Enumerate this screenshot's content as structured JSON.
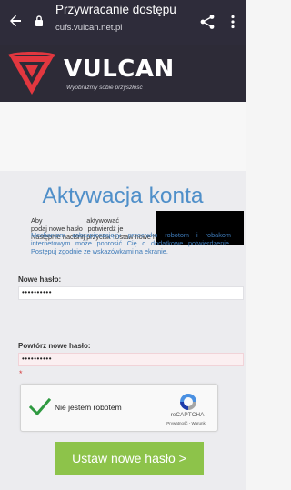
{
  "browser": {
    "title": "Przywracanie dostępu",
    "url": "cufs.vulcan.net.pl",
    "back_icon": "back-arrow-icon",
    "lock_icon": "lock-icon",
    "share_icon": "share-icon",
    "menu_icon": "more-vert-icon"
  },
  "brand": {
    "name": "VULCAN",
    "tagline": "Wyobraźmy sobie przyszłość",
    "colors": {
      "logo_red": "#e2373f",
      "header_bg": "#2d2b37"
    }
  },
  "card": {
    "title": "Aktywacja konta",
    "info_line1": "Aby aktywować konto ka",
    "info_line2": "podaj nowe hasło i potwierdź je",
    "info_line3": "Następnie naciśnij przycisk \"Ustaw nowe hasło\".",
    "captcha_note": "Mechanizm zabezpieczający przeciwko robotom i robakom internetowym może poprosić Cię o dodatkowe potwierdzenie. Postępuj zgodnie ze wskazówkami na ekranie.",
    "new_password_label": "Nowe hasło:",
    "new_password_value": "••••••••••",
    "repeat_password_label": "Powtórz nowe hasło:",
    "repeat_password_value": "••••••••••",
    "required_marker": "*",
    "submit_label": "Ustaw nowe hasło >"
  },
  "recaptcha": {
    "checkbox_label": "Nie jestem robotem",
    "brand": "reCAPTCHA",
    "links": "Prywatność - Warunki",
    "checked": true
  }
}
